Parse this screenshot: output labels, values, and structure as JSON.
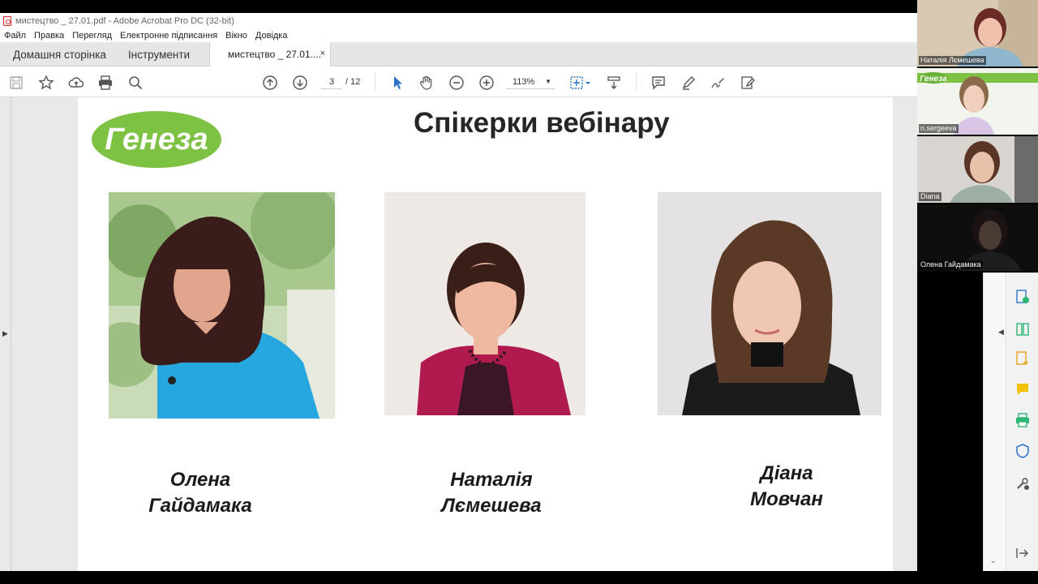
{
  "window": {
    "title": "мистецтво _ 27.01.pdf - Adobe Acrobat Pro DC (32-bit)"
  },
  "menu": [
    "Файл",
    "Правка",
    "Перегляд",
    "Електронне підписання",
    "Вікно",
    "Довідка"
  ],
  "tabs": {
    "home": "Домашня сторінка",
    "tools": "Інструменти",
    "document": "мистецтво _ 27.01....",
    "close": "×"
  },
  "toolbar": {
    "current_page": "3",
    "total_pages": "/ 12",
    "zoom": "113%"
  },
  "slide": {
    "title": "Спікерки вебінару",
    "logo_text": "Генеза",
    "speakers": [
      {
        "first": "Олена",
        "last": "Гайдамака"
      },
      {
        "first": "Наталія",
        "last": "Лємешева"
      },
      {
        "first": "Діана",
        "last": "Мовчан"
      }
    ]
  },
  "participants": [
    {
      "name": "Наталія Лємешева"
    },
    {
      "name": "n.sergeeva"
    },
    {
      "name": "Diana"
    },
    {
      "name": "Олена Гайдамака"
    }
  ],
  "colors": {
    "brand_green": "#7dc242",
    "acrobat_red": "#d22c2c",
    "tool_blue": "#2b73c9"
  }
}
